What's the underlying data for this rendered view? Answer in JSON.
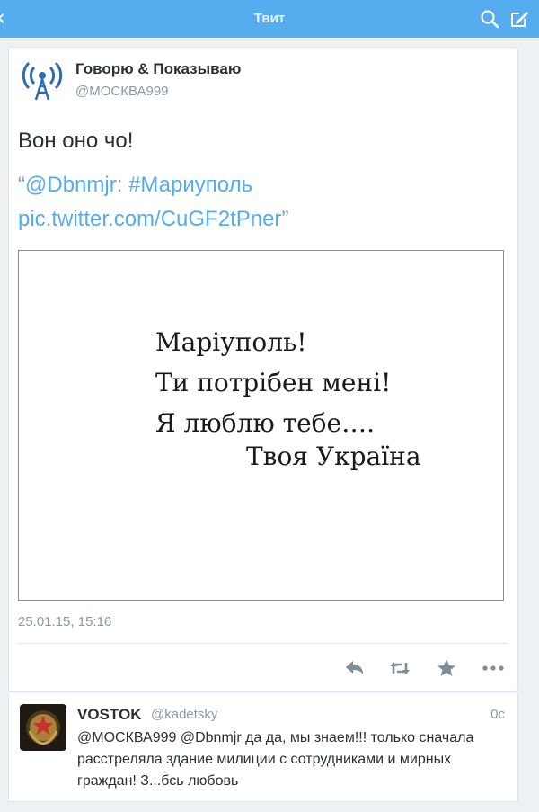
{
  "navbar": {
    "title": "Твит",
    "back_icon": "chevron-left-icon",
    "search_icon": "search-icon",
    "compose_icon": "compose-icon",
    "color": "#55acee"
  },
  "tweet": {
    "author_name": "Говорю & Показываю",
    "author_handle": "@МОСКВА999",
    "text": "Вон оно чо!",
    "quote": {
      "open": "“",
      "mention": "@Dbnmjr",
      "colon": ": ",
      "hashtag": "#Мариуполь",
      "link": "pic.twitter.com/CuGF2tPner",
      "close": "”"
    },
    "image_text": {
      "line1": "Маріуполь!",
      "line2": "Ти потрібен мені!",
      "line3": "Я люблю тебе….",
      "line4": "Твоя Україна"
    },
    "timestamp": "25.01.15, 15:16",
    "actions": [
      "reply-icon",
      "retweet-icon",
      "favorite-icon",
      "more-icon"
    ]
  },
  "reply": {
    "name": "VOSTOK",
    "handle": "@kadetsky",
    "time": "0c",
    "text": "@МОСКВА999 @Dbnmjr да да, мы знаем!!! только сначала расстреляла здание милиции с сотрудниками и мирных граждан! З...бсь любовь"
  }
}
